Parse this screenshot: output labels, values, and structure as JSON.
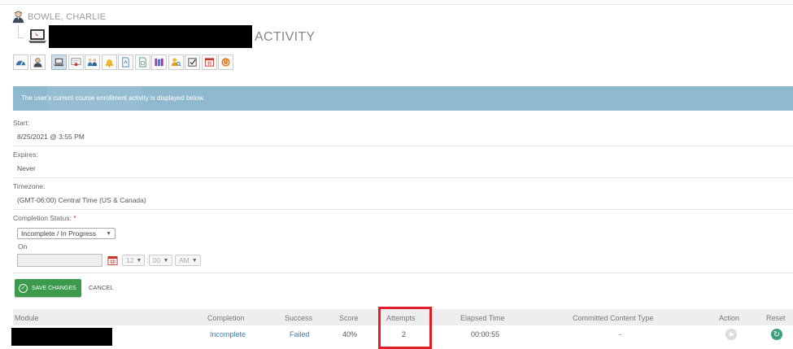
{
  "user": {
    "name": "BOWLE, CHARLIE"
  },
  "page": {
    "title_suffix": "ACTIVITY"
  },
  "toolbar": {
    "buttons": [
      {
        "icon": "dashboard-icon"
      },
      {
        "icon": "user-icon"
      },
      {
        "icon": "laptop-icon",
        "active": true
      },
      {
        "icon": "certificate-icon"
      },
      {
        "icon": "group-icon"
      },
      {
        "icon": "bell-icon"
      },
      {
        "icon": "document-icon"
      },
      {
        "icon": "spreadsheet-icon"
      },
      {
        "icon": "books-icon"
      },
      {
        "icon": "user-search-icon"
      },
      {
        "icon": "checkbox-icon"
      },
      {
        "icon": "calendar-icon"
      },
      {
        "icon": "power-icon"
      }
    ]
  },
  "banner": {
    "text": "The user's current course enrollment activity is displayed below."
  },
  "fields": {
    "start": {
      "label": "Start:",
      "value": "8/25/2021 @ 3:55 PM"
    },
    "expires": {
      "label": "Expires:",
      "value": "Never"
    },
    "timezone": {
      "label": "Timezone:",
      "value": "(GMT-06:00) Central Time (US & Canada)"
    },
    "completion": {
      "label": "Completion Status:",
      "required_mark": "*",
      "selected": "Incomplete / In Progress",
      "on_label": "On",
      "date_value": "",
      "hour": "12",
      "minute": "00",
      "ampm": "AM",
      "time_separator": ":"
    }
  },
  "actions": {
    "save_label": "SAVE CHANGES",
    "cancel_label": "CANCEL"
  },
  "table": {
    "headers": [
      "Module",
      "Completion",
      "Success",
      "Score",
      "Attempts",
      "Elapsed Time",
      "Committed Content Type",
      "Action",
      "Reset"
    ],
    "rows": [
      {
        "module": "",
        "completion": "Incomplete",
        "success": "Failed",
        "score": "40%",
        "attempts": "2",
        "elapsed": "00:00:55",
        "content_type": "-"
      }
    ]
  },
  "colors": {
    "banner": "#8fb9cf",
    "save": "#3c9a4c",
    "link": "#3d7fb5",
    "highlight": "#e01f26"
  }
}
